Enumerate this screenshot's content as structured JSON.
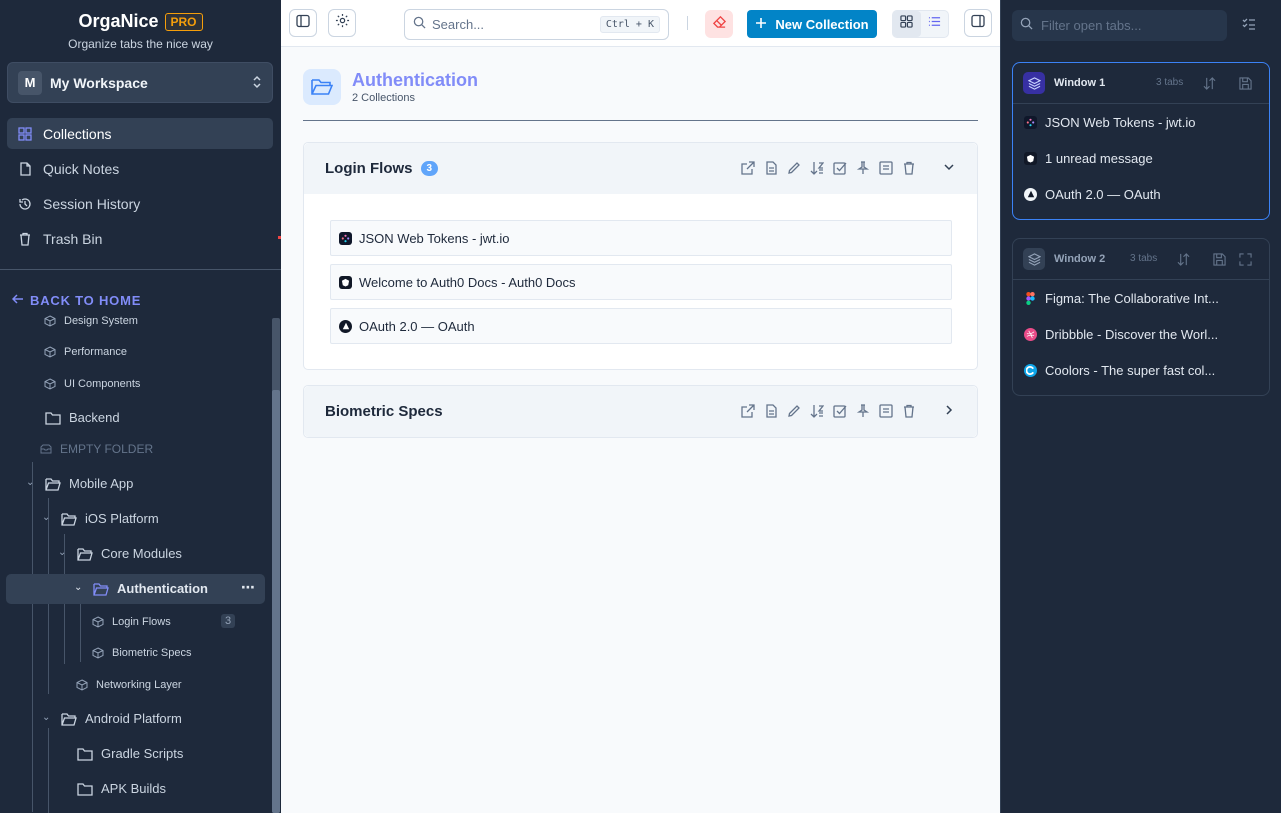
{
  "brand": {
    "name": "OrgaNice",
    "badge": "PRO",
    "tagline": "Organize tabs the nice way"
  },
  "workspace": {
    "initial": "M",
    "name": "My Workspace"
  },
  "nav": [
    {
      "label": "Collections",
      "icon": "grid-icon",
      "active": true
    },
    {
      "label": "Quick Notes",
      "icon": "file-icon",
      "active": false
    },
    {
      "label": "Session History",
      "icon": "history-icon",
      "active": false
    },
    {
      "label": "Trash Bin",
      "icon": "trash-icon",
      "active": false
    }
  ],
  "back_label": "BACK TO HOME",
  "tree": {
    "design_system": "Design System",
    "performance": "Performance",
    "ui_components": "UI Components",
    "backend": "Backend",
    "empty_folder": "EMPTY FOLDER",
    "mobile_app": "Mobile App",
    "ios_platform": "iOS Platform",
    "core_modules": "Core Modules",
    "authentication": "Authentication",
    "login_flows": "Login Flows",
    "login_flows_count": "3",
    "biometric_specs": "Biometric Specs",
    "networking_layer": "Networking Layer",
    "android_platform": "Android Platform",
    "gradle_scripts": "Gradle Scripts",
    "apk_builds": "APK Builds",
    "more_label": "⋯"
  },
  "toolbar": {
    "search_placeholder": "Search...",
    "shortcut": "Ctrl + K",
    "new_collection": "New Collection"
  },
  "page": {
    "title": "Authentication",
    "subtitle": "2 Collections"
  },
  "collections": [
    {
      "title": "Login Flows",
      "count": "3",
      "expanded": true,
      "tabs": [
        {
          "title": "JSON Web Tokens - jwt.io",
          "favicon": "jwt-favicon"
        },
        {
          "title": "Welcome to Auth0 Docs - Auth0 Docs",
          "favicon": "auth0-favicon"
        },
        {
          "title": "OAuth 2.0 — OAuth",
          "favicon": "oauth-favicon"
        }
      ]
    },
    {
      "title": "Biometric Specs",
      "expanded": false,
      "tabs": []
    }
  ],
  "right": {
    "filter_placeholder": "Filter open tabs...",
    "windows": [
      {
        "title": "Window 1",
        "count": "3 tabs",
        "active": true,
        "tabs": [
          {
            "title": "JSON Web Tokens - jwt.io",
            "favicon": "jwt-favicon"
          },
          {
            "title": "1 unread message",
            "favicon": "auth0-favicon"
          },
          {
            "title": "OAuth 2.0 — OAuth",
            "favicon": "oauth-favicon"
          }
        ]
      },
      {
        "title": "Window 2",
        "count": "3 tabs",
        "active": false,
        "tabs": [
          {
            "title": "Figma: The Collaborative Int...",
            "favicon": "figma-favicon"
          },
          {
            "title": "Dribbble - Discover the Worl...",
            "favicon": "dribbble-favicon"
          },
          {
            "title": "Coolors - The super fast col...",
            "favicon": "coolors-favicon"
          }
        ]
      }
    ]
  },
  "colors": {
    "accent": "#818cf8",
    "primary_button": "#0284c7",
    "sidebar_bg": "#1e293b",
    "pill": "#60a5fa"
  }
}
